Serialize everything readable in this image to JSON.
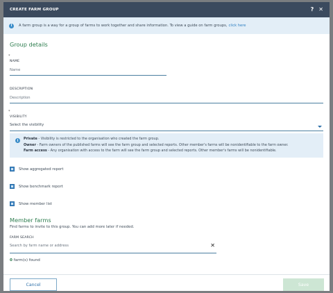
{
  "dialog": {
    "title": "CREATE FARM GROUP",
    "help_icon": "question-icon",
    "close_icon": "close-icon"
  },
  "info_banner": {
    "text": "A farm group is a way for a group of farms to work together and share information. To view a guide on farm groups,",
    "link": "click here"
  },
  "group_details": {
    "heading": "Group details",
    "name_label": "NAME",
    "name_placeholder": "Name",
    "description_label": "DESCRIPTION",
    "description_placeholder": "Description",
    "visibility_label": "VISIBILITY",
    "visibility_value": "Select the visibility"
  },
  "visibility_note": {
    "private_term": "Private",
    "private_text": " - Visibility is restricted to the organisation who created the farm group.",
    "owner_term": "Owner",
    "owner_text": " - Farm owners of the published farms will see the farm group and selected reports. Other member's farms will be nonidentifiable to the farm owner.",
    "access_term": "Farm access",
    "access_text": " - Any organisation with access to the farm will see the farm group and selected reports. Other member's farms will be nonidentifiable."
  },
  "options": [
    {
      "label": "Show aggregated report",
      "checked": true
    },
    {
      "label": "Show benchmark report",
      "checked": true
    },
    {
      "label": "Show member list",
      "checked": true
    }
  ],
  "member_farms": {
    "heading": "Member farms",
    "description": "Find farms to invite to this group. You can add more later if needed.",
    "search_label": "FARM SEARCH",
    "search_placeholder": "Search by farm name or address",
    "found_count": "0",
    "found_text": "farm(s) found"
  },
  "footer": {
    "cancel_label": "Cancel",
    "save_label": "Save"
  },
  "colors": {
    "titlebar": "#3b4a5e",
    "accent_green": "#2e7d4f",
    "accent_blue": "#3d86c5",
    "info_bg": "#e3eef7"
  }
}
